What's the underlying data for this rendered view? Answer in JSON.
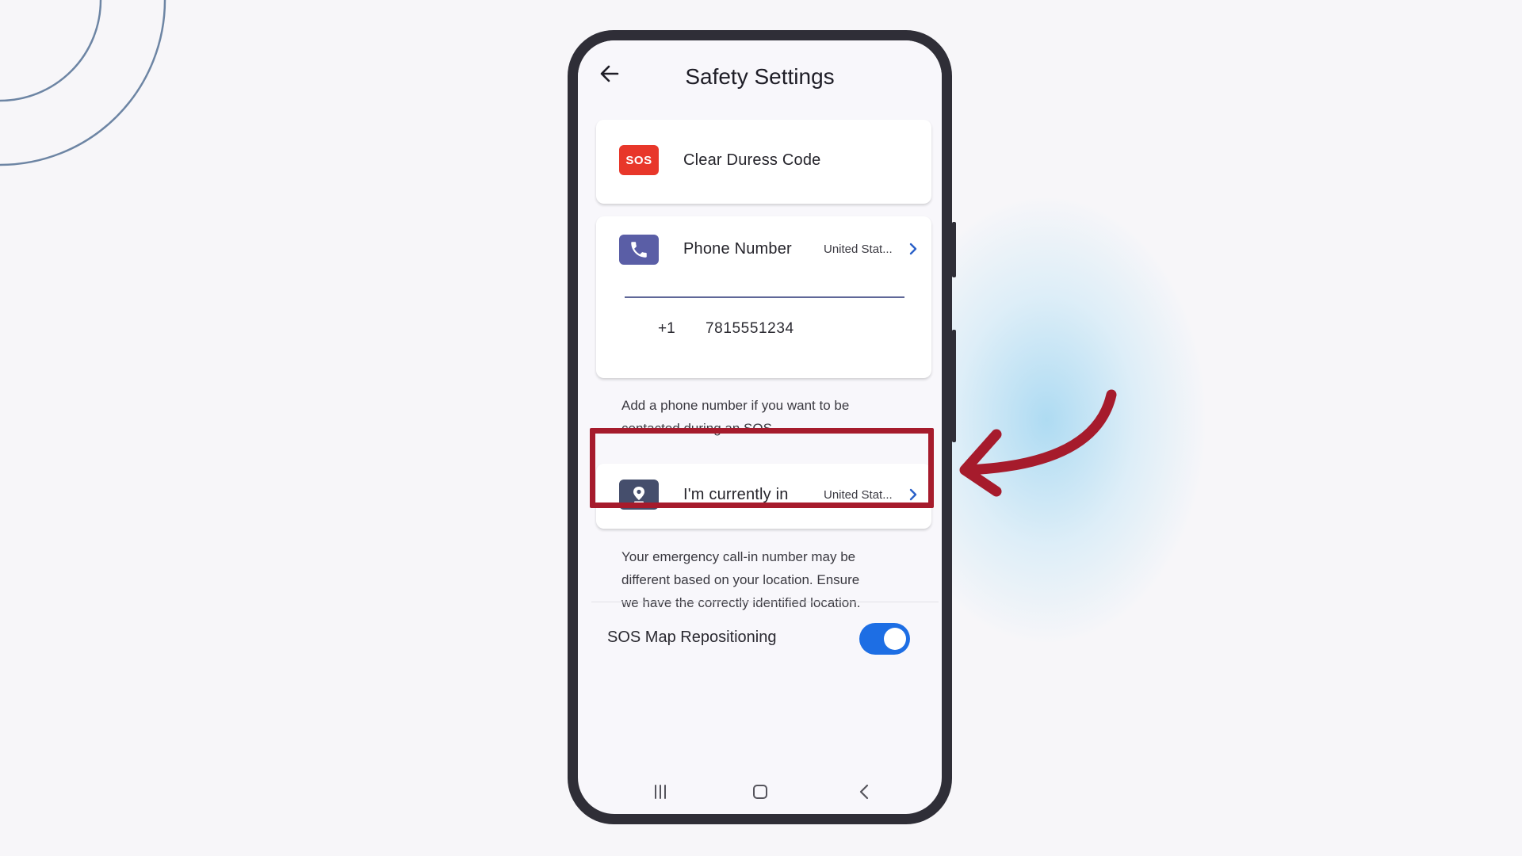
{
  "header": {
    "title": "Safety Settings"
  },
  "duress_card": {
    "icon_text": "SOS",
    "label": "Clear Duress Code"
  },
  "phone_card": {
    "label": "Phone Number",
    "country": "United Stat...",
    "prefix": "+1",
    "number": "7815551234"
  },
  "phone_helper": [
    "Add a phone number if you want to be",
    "contacted during an SOS."
  ],
  "location_card": {
    "label": "I'm currently in",
    "country": "United Stat..."
  },
  "location_helper": [
    "Your emergency call-in number may be",
    "different based on your location. Ensure",
    "we have the correctly identified location."
  ],
  "sos_map": {
    "label": "SOS Map Repositioning",
    "enabled": true
  },
  "colors": {
    "accent": "#1d6ee4",
    "sos_red": "#e8372a",
    "highlight": "#a61b2c",
    "phone_tile": "#5a5ea6",
    "location_tile": "#454e6c"
  },
  "icons": [
    "back-arrow-icon",
    "sos-icon",
    "phone-icon",
    "location-pin-icon",
    "chevron-right-icon",
    "recent-apps-icon",
    "home-icon",
    "nav-back-icon",
    "curved-arrow-icon"
  ]
}
